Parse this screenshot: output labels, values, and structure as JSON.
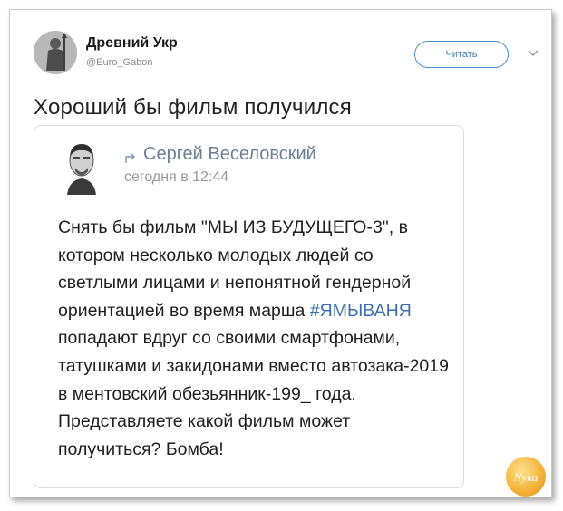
{
  "tweet": {
    "author_name": "Древний Укр",
    "author_handle": "@Euro_Gabon",
    "follow_label": "Читать",
    "text": "Хороший бы фильм получился"
  },
  "embedded_post": {
    "author_name": "Сергей Веселовский",
    "timestamp": "сегодня в 12:44",
    "body_part1": "Снять бы фильм \"МЫ ИЗ БУДУЩЕГО-3\", в котором несколько молодых людей со светлыми лицами и непонятной гендерной ориентацией во время марша ",
    "hashtag": "#ЯМЫВАНЯ",
    "body_part2": " попадают вдруг со своими смартфонами, татушками и закидонами вместо автозака-2019 в ментовский обезьянник-199_ года.",
    "body_part3": "Представляете какой фильм может получиться? Бомба!"
  },
  "watermark": {
    "text": "Nyka"
  },
  "colors": {
    "accent": "#4a90c8",
    "hashtag": "#3d6fb0",
    "author_link": "#6c7f92"
  },
  "icons": [
    "avatar",
    "chevron-down-icon",
    "share-icon",
    "watermark-logo"
  ]
}
